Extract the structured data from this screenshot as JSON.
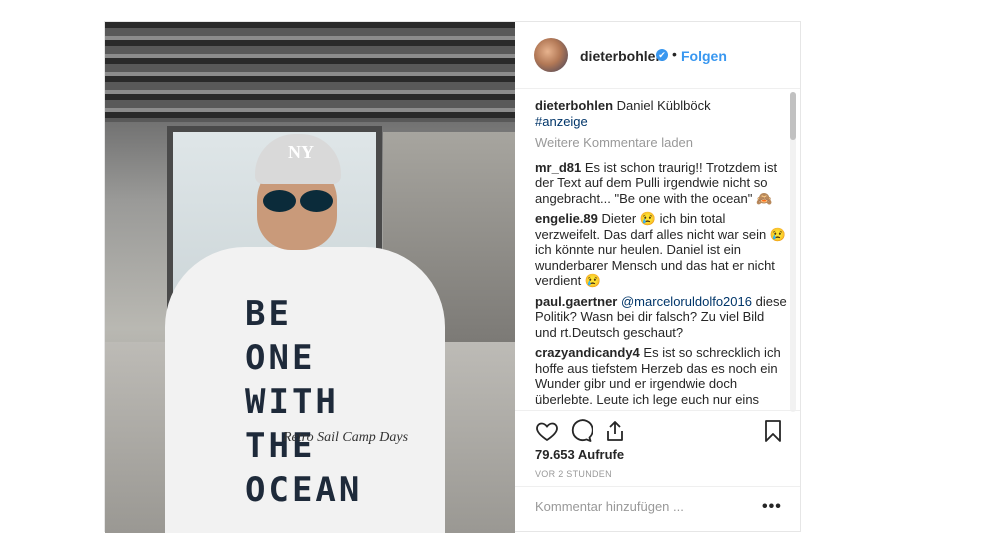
{
  "post": {
    "username": "dieterbohlen",
    "verified_badge": "✔",
    "separator": "•",
    "follow_label": "Folgen",
    "caption": {
      "username": "dieterbohlen",
      "text": "Daniel Küblböck",
      "hashtag": "#anzeige"
    },
    "load_more_label": "Weitere Kommentare laden",
    "comments": [
      {
        "user": "mr_d81",
        "text": "Es ist schon traurig!! Trotzdem ist der Text auf dem Pulli irgendwie nicht so angebracht... \"Be one with the ocean\" 🙈"
      },
      {
        "user": "engelie.89",
        "text": "Dieter 😢 ich bin total verzweifelt. Das darf alles nicht war sein 😢 ich könnte nur heulen. Daniel ist ein wunderbarer Mensch und das hat er nicht verdient 😢"
      },
      {
        "user": "paul.gaertner",
        "mention": "@marceloruldolfo2016",
        "text": "diese Politik? Wasn bei dir falsch? Zu viel Bild und rt.Deutsch geschaut?"
      },
      {
        "user": "crazyandicandy4",
        "text": "Es ist so schrecklich ich hoffe aus tiefstem Herzeb das es noch ein Wunder gibr und er irgendwie doch überlebte. Leute ich lege euch nur eins"
      }
    ],
    "views": "79.653 Aufrufe",
    "timestamp": "VOR 2 STUNDEN",
    "comment_placeholder": "Kommentar hinzufügen ...",
    "more_label": "•••",
    "media": {
      "cap_logo": "NY",
      "hoodie_text": [
        "BE ONE",
        "WITH THE",
        "OCEAN"
      ],
      "hoodie_script": "Retro Sail Camp Days"
    }
  },
  "colors": {
    "accent": "#3897f0",
    "text": "#262626",
    "muted": "#999999",
    "border": "#efefef"
  },
  "icons": [
    "heart-icon",
    "comment-icon",
    "share-icon",
    "bookmark-icon",
    "verified-icon"
  ]
}
